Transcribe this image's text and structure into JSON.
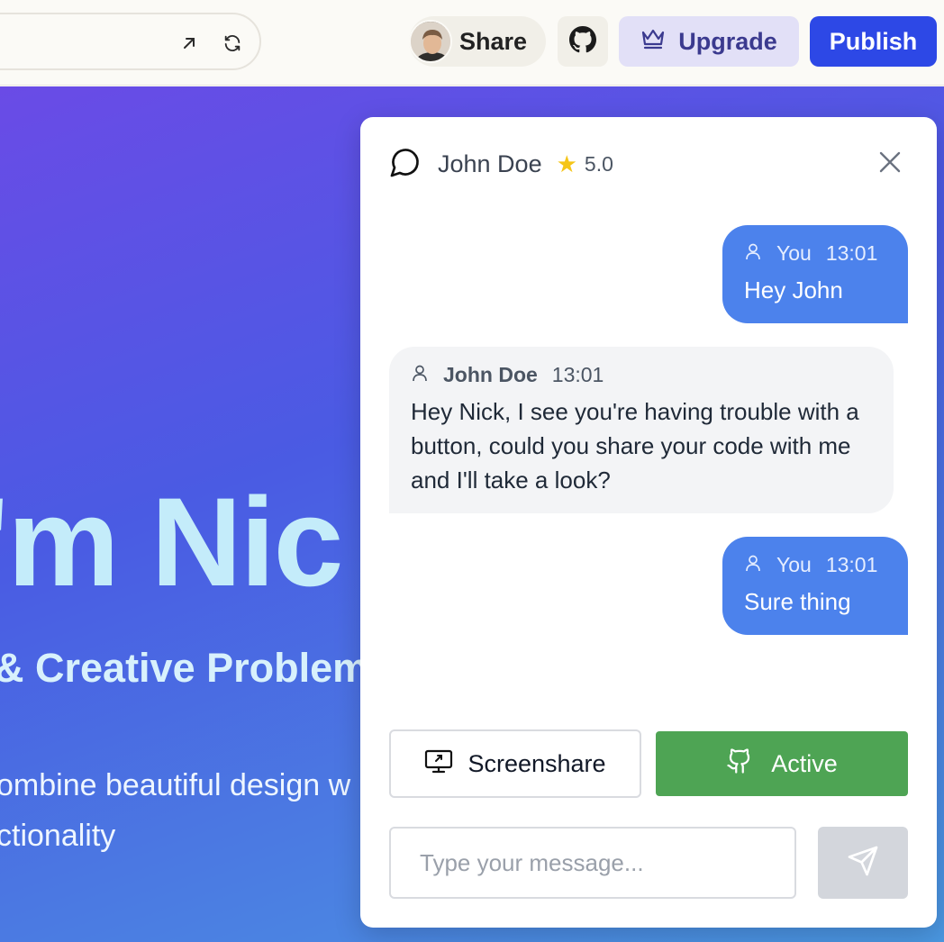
{
  "toolbar": {
    "share_label": "Share",
    "upgrade_label": "Upgrade",
    "publish_label": "Publish",
    "icons": [
      "open-external-icon",
      "refresh-icon",
      "github-icon",
      "crown-icon"
    ]
  },
  "hero": {
    "title": "I'm Nic",
    "subtitle": "& Creative Problem",
    "body_line1": "ombine beautiful design w",
    "body_line2": "ctionality"
  },
  "chat": {
    "contact_name": "John Doe",
    "rating": "5.0",
    "messages": [
      {
        "sender": "You",
        "time": "13:01",
        "text": "Hey John",
        "direction": "outgoing"
      },
      {
        "sender": "John Doe",
        "time": "13:01",
        "text": "Hey Nick, I see you're having trouble with a button, could you share your code with me and I'll take a look?",
        "direction": "incoming"
      },
      {
        "sender": "You",
        "time": "13:01",
        "text": "Sure thing",
        "direction": "outgoing"
      }
    ],
    "screenshare_label": "Screenshare",
    "active_label": "Active",
    "input_placeholder": "Type your message..."
  },
  "colors": {
    "publish": "#2d48e6",
    "upgrade_bg": "#e2e0f7",
    "outgoing_bubble": "#4c82ec",
    "incoming_bubble": "#f3f4f6",
    "active_button": "#4ea454",
    "send_button": "#d3d6dc",
    "star": "#f5c518"
  }
}
